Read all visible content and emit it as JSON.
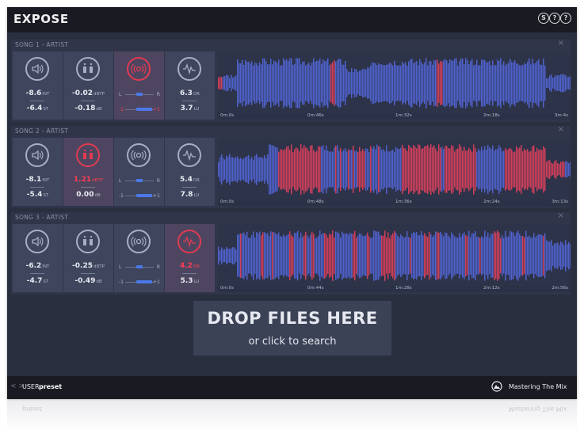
{
  "app": {
    "title": "EXPOSE"
  },
  "top_buttons": [
    {
      "glyph": "S",
      "name": "settings"
    },
    {
      "glyph": "?",
      "name": "tips"
    },
    {
      "glyph": "?",
      "name": "help"
    }
  ],
  "colors": {
    "background": "#2a2f40",
    "panel": "#3e455c",
    "accent_blue": "#4b78e8",
    "alert_red": "#e23a52",
    "bar": "#1a1b22"
  },
  "songs": [
    {
      "title": "SONG 1 - ARTIST",
      "close": "×",
      "loudness": {
        "integrated": "-8.6",
        "int_unit": "INT",
        "short_term": "-6.4",
        "st_unit": "ST",
        "alert": false
      },
      "true_peak": {
        "value": "-0.02",
        "unit": "dBTP",
        "gain": "-0.18",
        "gain_unit": "dB",
        "alert": false
      },
      "stereo": {
        "left": "L",
        "right": "R",
        "neg": "-1",
        "pos": "+1",
        "balance": 0.0,
        "correlation": 0.7,
        "alert": true
      },
      "dynamics": {
        "dr": "6.3",
        "dr_unit": "DR",
        "lu": "3.7",
        "lu_unit": "LU",
        "alert": false
      },
      "timestamps": [
        "0m:0s",
        "0m:46s",
        "1m:32s",
        "2m:18s",
        "3m:4s"
      ]
    },
    {
      "title": "SONG 2 - ARTIST",
      "close": "×",
      "loudness": {
        "integrated": "-8.1",
        "int_unit": "INT",
        "short_term": "-5.4",
        "st_unit": "ST",
        "alert": false
      },
      "true_peak": {
        "value": "1.21",
        "unit": "dBTP",
        "gain": "0.00",
        "gain_unit": "dB",
        "alert": true
      },
      "stereo": {
        "left": "L",
        "right": "R",
        "neg": "-1",
        "pos": "+1",
        "balance": 0.0,
        "correlation": 0.72,
        "alert": false
      },
      "dynamics": {
        "dr": "5.4",
        "dr_unit": "DR",
        "lu": "7.8",
        "lu_unit": "LU",
        "alert": false
      },
      "timestamps": [
        "0m:0s",
        "0m:48s",
        "1m:36s",
        "2m:24s",
        "3m:13s"
      ]
    },
    {
      "title": "SONG 3 - ARTIST",
      "close": "×",
      "loudness": {
        "integrated": "-6.2",
        "int_unit": "INT",
        "short_term": "-4.7",
        "st_unit": "ST",
        "alert": false
      },
      "true_peak": {
        "value": "-0.25",
        "unit": "dBTP",
        "gain": "-0.49",
        "gain_unit": "dB",
        "alert": false
      },
      "stereo": {
        "left": "L",
        "right": "R",
        "neg": "-1",
        "pos": "+1",
        "balance": 0.0,
        "correlation": 0.7,
        "alert": false
      },
      "dynamics": {
        "dr": "4.2",
        "dr_unit": "DR",
        "lu": "5.3",
        "lu_unit": "LU",
        "alert": true
      },
      "timestamps": [
        "0m:0s",
        "0m:44s",
        "1m:28s",
        "2m:12s",
        "2m:56s"
      ]
    }
  ],
  "drop_zone": {
    "title": "DROP FILES HERE",
    "subtitle": "or click to search"
  },
  "footer": {
    "arrows": "< >",
    "user": "USER",
    "preset": "preset",
    "brand": "Mastering The Mix"
  }
}
